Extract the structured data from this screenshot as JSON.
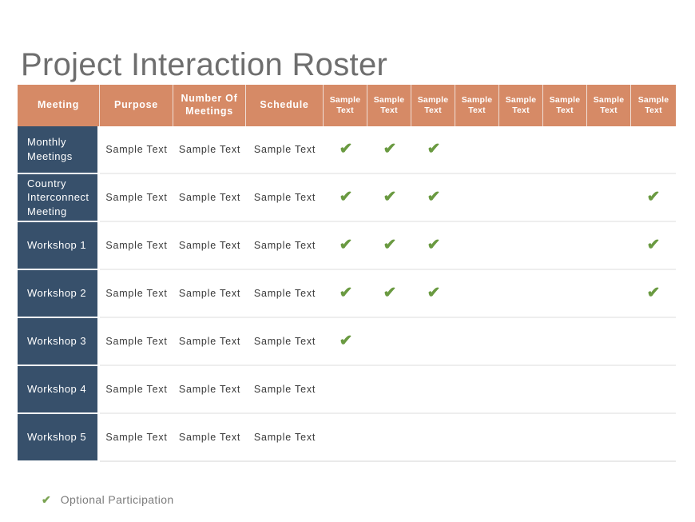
{
  "page": {
    "title": "Project Interaction Roster",
    "background_color": "#ffffff",
    "title_color": "#6e6e6e"
  },
  "colors": {
    "header_orange": "#d68a66",
    "row_label_navy": "#37506b",
    "check_green": "#6a9a41",
    "legend_green": "#7aa352",
    "body_text": "#3a3a3a",
    "row_divider": "#eeeeee"
  },
  "table": {
    "columns": [
      {
        "key": "meeting",
        "label": "Meeting",
        "type": "main"
      },
      {
        "key": "purpose",
        "label": "Purpose",
        "type": "main"
      },
      {
        "key": "number_of_meetings",
        "label": "Number Of Meetings",
        "type": "main"
      },
      {
        "key": "schedule",
        "label": "Schedule",
        "type": "main"
      },
      {
        "key": "s1",
        "label": "Sample Text",
        "type": "sample"
      },
      {
        "key": "s2",
        "label": "Sample Text",
        "type": "sample"
      },
      {
        "key": "s3",
        "label": "Sample Text",
        "type": "sample"
      },
      {
        "key": "s4",
        "label": "Sample Text",
        "type": "sample"
      },
      {
        "key": "s5",
        "label": "Sample Text",
        "type": "sample"
      },
      {
        "key": "s6",
        "label": "Sample Text",
        "type": "sample"
      },
      {
        "key": "s7",
        "label": "Sample Text",
        "type": "sample"
      },
      {
        "key": "s8",
        "label": "Sample Text",
        "type": "sample"
      }
    ],
    "check_glyph": "✔",
    "rows": [
      {
        "meeting": "Monthly Meetings",
        "purpose": "Sample Text",
        "number_of_meetings": "Sample Text",
        "schedule": "Sample Text",
        "checks": [
          true,
          true,
          true,
          false,
          false,
          false,
          false,
          false
        ]
      },
      {
        "meeting": "Country Interconnect Meeting",
        "purpose": "Sample Text",
        "number_of_meetings": "Sample Text",
        "schedule": "Sample Text",
        "checks": [
          true,
          true,
          true,
          false,
          false,
          false,
          false,
          true
        ]
      },
      {
        "meeting": "Workshop 1",
        "purpose": "Sample Text",
        "number_of_meetings": "Sample Text",
        "schedule": "Sample Text",
        "checks": [
          true,
          true,
          true,
          false,
          false,
          false,
          false,
          true
        ]
      },
      {
        "meeting": "Workshop 2",
        "purpose": "Sample Text",
        "number_of_meetings": "Sample Text",
        "schedule": "Sample Text",
        "checks": [
          true,
          true,
          true,
          false,
          false,
          false,
          false,
          true
        ]
      },
      {
        "meeting": "Workshop 3",
        "purpose": "Sample Text",
        "number_of_meetings": "Sample Text",
        "schedule": "Sample Text",
        "checks": [
          true,
          false,
          false,
          false,
          false,
          false,
          false,
          false
        ]
      },
      {
        "meeting": "Workshop 4",
        "purpose": "Sample Text",
        "number_of_meetings": "Sample Text",
        "schedule": "Sample Text",
        "checks": [
          false,
          false,
          false,
          false,
          false,
          false,
          false,
          false
        ]
      },
      {
        "meeting": "Workshop 5",
        "purpose": "Sample Text",
        "number_of_meetings": "Sample Text",
        "schedule": "Sample Text",
        "checks": [
          false,
          false,
          false,
          false,
          false,
          false,
          false,
          false
        ]
      }
    ]
  },
  "legend": {
    "icon": "check-icon",
    "glyph": "✔",
    "label": "Optional Participation"
  }
}
